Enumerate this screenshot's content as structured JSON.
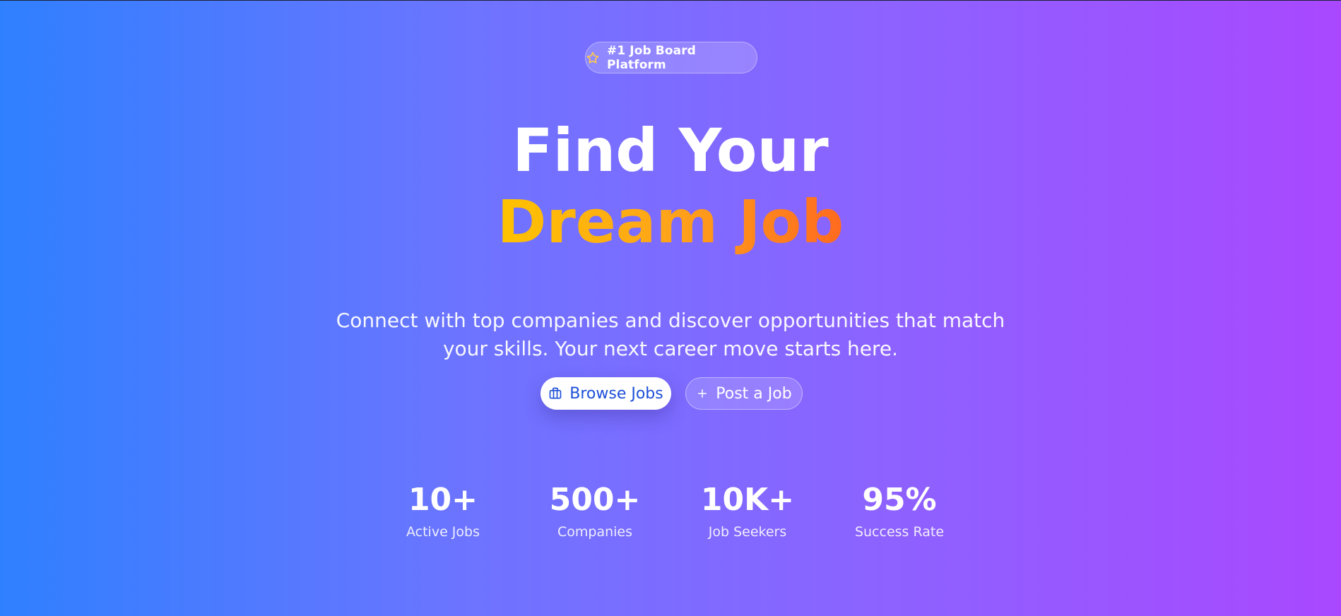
{
  "badge": {
    "icon": "star-icon",
    "label": "#1 Job Board Platform"
  },
  "hero": {
    "title_line1": "Find Your",
    "title_line2": "Dream Job",
    "subtitle": "Connect with top companies and discover opportunities that match your skills. Your next career move starts here."
  },
  "actions": {
    "browse": {
      "icon": "briefcase-icon",
      "label": "Browse Jobs"
    },
    "post": {
      "icon": "plus-icon",
      "label": "Post a Job"
    }
  },
  "stats": [
    {
      "value": "10+",
      "label": "Active Jobs"
    },
    {
      "value": "500+",
      "label": "Companies"
    },
    {
      "value": "10K+",
      "label": "Job Seekers"
    },
    {
      "value": "95%",
      "label": "Success Rate"
    }
  ],
  "colors": {
    "gradient_start": "#2f80ff",
    "gradient_end": "#a948ff",
    "accent_start": "#ffc300",
    "accent_end": "#ff6a1f",
    "button_text": "#1d4fd8"
  }
}
